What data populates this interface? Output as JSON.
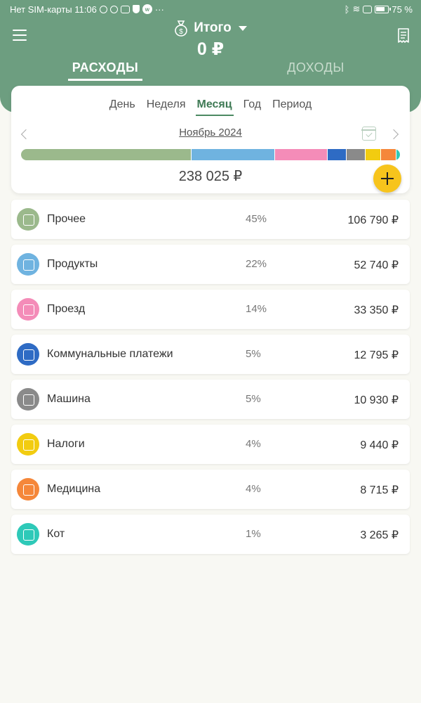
{
  "status": {
    "carrier": "Нет SIM-карты 11:06",
    "battery": "75 %"
  },
  "header": {
    "title": "Итого",
    "total": "0 ₽",
    "tabs": [
      {
        "label": "РАСХОДЫ",
        "active": true
      },
      {
        "label": "ДОХОДЫ",
        "active": false
      }
    ],
    "bg_color": "#6d9e80"
  },
  "period": {
    "tabs": [
      {
        "label": "День",
        "active": false
      },
      {
        "label": "Неделя",
        "active": false
      },
      {
        "label": "Месяц",
        "active": true
      },
      {
        "label": "Год",
        "active": false
      },
      {
        "label": "Период",
        "active": false
      }
    ],
    "month": "Ноябрь 2024",
    "sum": "238 025 ₽"
  },
  "categories": [
    {
      "name": "Прочее",
      "percent": "45%",
      "share": 0.45,
      "amount": "106 790 ₽",
      "color": "#9bb98c",
      "icon": "money-bills-icon"
    },
    {
      "name": "Продукты",
      "percent": "22%",
      "share": 0.22,
      "amount": "52 740 ₽",
      "color": "#6fb3e0",
      "icon": "grocery-basket-icon"
    },
    {
      "name": "Проезд",
      "percent": "14%",
      "share": 0.14,
      "amount": "33 350 ₽",
      "color": "#f48cb8",
      "icon": "bus-icon"
    },
    {
      "name": "Коммунальные платежи",
      "percent": "5%",
      "share": 0.05,
      "amount": "12 795 ₽",
      "color": "#2e6bc4",
      "icon": "house-icon"
    },
    {
      "name": "Машина",
      "percent": "5%",
      "share": 0.05,
      "amount": "10 930 ₽",
      "color": "#8a8a8a",
      "icon": "car-icon"
    },
    {
      "name": "Налоги",
      "percent": "4%",
      "share": 0.04,
      "amount": "9 440 ₽",
      "color": "#f2cc10",
      "icon": "lightbulb-icon"
    },
    {
      "name": "Медицина",
      "percent": "4%",
      "share": 0.04,
      "amount": "8 715 ₽",
      "color": "#f5873a",
      "icon": "pill-icon"
    },
    {
      "name": "Кот",
      "percent": "1%",
      "share": 0.01,
      "amount": "3 265 ₽",
      "color": "#2ec9b8",
      "icon": "paw-icon"
    }
  ]
}
